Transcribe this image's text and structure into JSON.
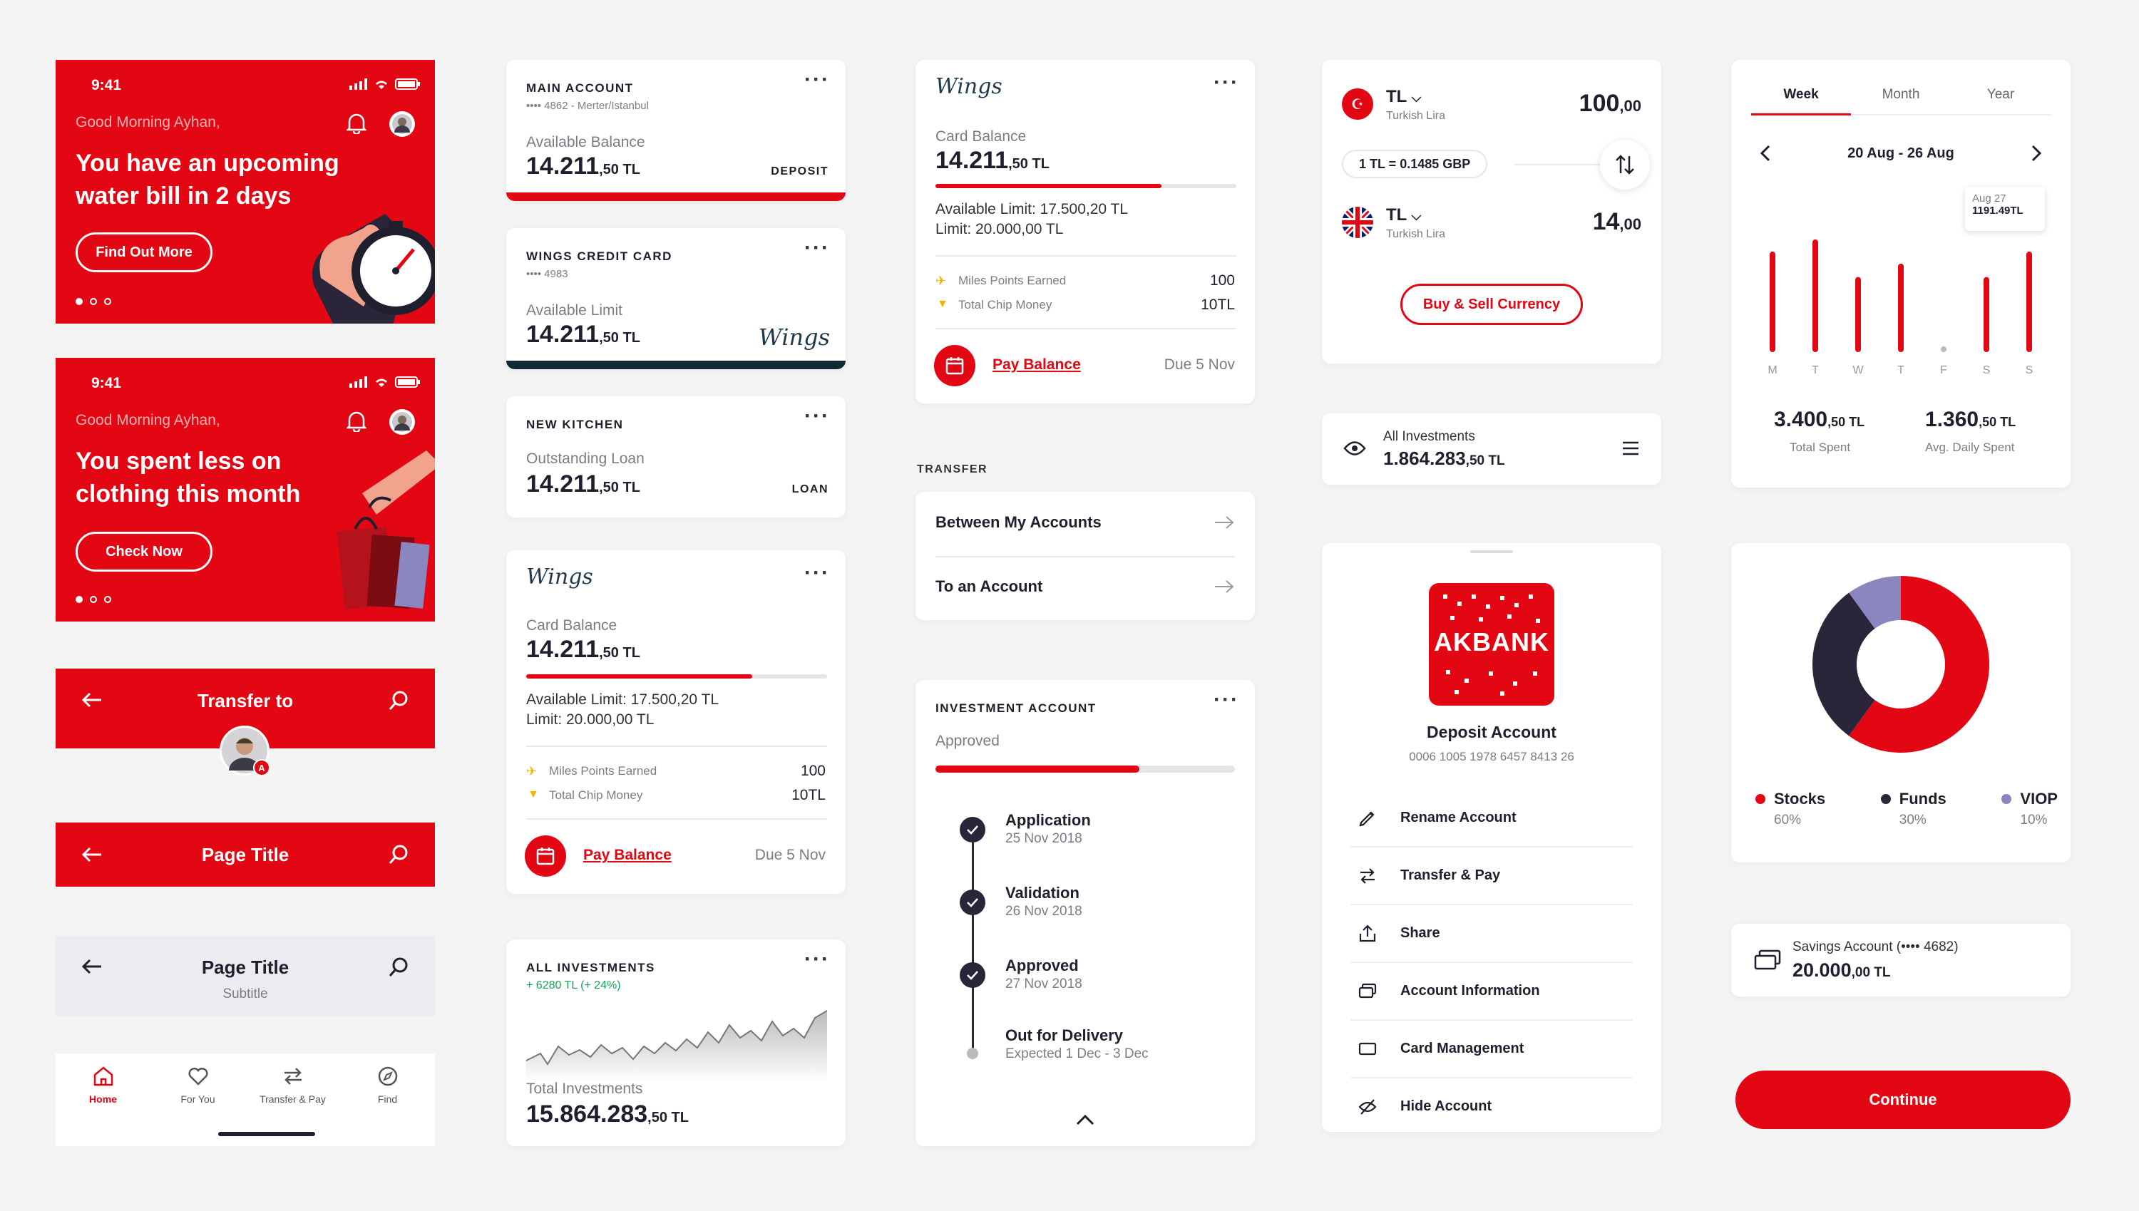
{
  "promo1": {
    "time": "9:41",
    "greeting": "Good Morning Ayhan,",
    "line1": "You have an upcoming",
    "line2": "water bill in 2 days",
    "button": "Find Out More"
  },
  "promo2": {
    "time": "9:41",
    "greeting": "Good Morning Ayhan,",
    "line1": "You spent less on",
    "line2": "clothing this month",
    "button": "Check Now"
  },
  "nav_transfer": {
    "title": "Transfer to"
  },
  "nav_red": {
    "title": "Page Title"
  },
  "nav_grey": {
    "title": "Page Title",
    "subtitle": "Subtitle"
  },
  "tabbar": {
    "items": [
      {
        "label": "Home",
        "icon": "home-icon"
      },
      {
        "label": "For You",
        "icon": "heart-icon"
      },
      {
        "label": "Transfer & Pay",
        "icon": "transfer-icon"
      },
      {
        "label": "Find",
        "icon": "compass-icon"
      }
    ]
  },
  "main_account": {
    "title": "MAIN ACCOUNT",
    "sub": "•••• 4862 - Merter/Istanbul",
    "label": "Available Balance",
    "amount": "14.211",
    "decimals": ",50 TL",
    "tag": "DEPOSIT"
  },
  "credit_card": {
    "title": "WINGS CREDIT CARD",
    "sub": "•••• 4983",
    "label": "Available Limit",
    "amount": "14.211",
    "decimals": ",50 TL",
    "brand": "Wings"
  },
  "kitchen": {
    "title": "NEW KITCHEN",
    "label": "Outstanding Loan",
    "amount": "14.211",
    "decimals": ",50 TL",
    "tag": "LOAN"
  },
  "wings_card": {
    "brand": "Wings",
    "label": "Card Balance",
    "amount": "14.211",
    "decimals": ",50 TL",
    "limit1": "Available Limit: 17.500,20 TL",
    "limit2": "Limit: 20.000,00 TL",
    "miles_label": "Miles Points Earned",
    "miles_value": "100",
    "chip_label": "Total Chip Money",
    "chip_value": "10TL",
    "pay": "Pay Balance",
    "due": "Due 5 Nov",
    "progress": 0.75
  },
  "investments_small": {
    "title": "ALL INVESTMENTS",
    "change": "+ 6280 TL (+ 24%)",
    "label": "Total Investments",
    "amount": "15.864.283",
    "decimals": ",50 TL"
  },
  "transfer": {
    "header": "TRANSFER",
    "items": [
      "Between My Accounts",
      "To an Account"
    ]
  },
  "investment_account": {
    "title": "INVESTMENT ACCOUNT",
    "status": "Approved",
    "progress": 0.68,
    "steps": [
      {
        "title": "Application",
        "date": "25 Nov 2018"
      },
      {
        "title": "Validation",
        "date": "26 Nov 2018"
      },
      {
        "title": "Approved",
        "date": "27 Nov 2018"
      },
      {
        "title": "Out for Delivery",
        "date": "Expected 1 Dec - 3 Dec"
      }
    ]
  },
  "currency": {
    "from_code": "TL",
    "from_name": "Turkish Lira",
    "from_amount": "100",
    "from_dec": ",00",
    "rate": "1 TL = 0.1485 GBP",
    "to_code": "TL",
    "to_name": "Turkish Lira",
    "to_amount": "14",
    "to_dec": ",00",
    "button": "Buy & Sell Currency"
  },
  "all_investments": {
    "label": "All Investments",
    "amount": "1.864.283",
    "decimals": ",50 TL"
  },
  "deposit": {
    "logo": "AKBANK",
    "title": "Deposit Account",
    "iban": "0006 1005 1978 6457 8413 26",
    "menu": [
      {
        "label": "Rename Account",
        "icon": "pencil-icon"
      },
      {
        "label": "Transfer & Pay",
        "icon": "transfer-icon"
      },
      {
        "label": "Share",
        "icon": "share-icon"
      },
      {
        "label": "Account Information",
        "icon": "cards-icon"
      },
      {
        "label": "Card Management",
        "icon": "card-icon"
      },
      {
        "label": "Hide Account",
        "icon": "eye-off-icon"
      }
    ]
  },
  "spending": {
    "tabs": [
      "Week",
      "Month",
      "Year"
    ],
    "range": "20 Aug - 26 Aug",
    "tooltip_date": "Aug 27",
    "tooltip_value": "1191.49TL",
    "total_amount": "3.400",
    "total_dec": ",50 TL",
    "total_label": "Total Spent",
    "avg_amount": "1.360",
    "avg_dec": ",50 TL",
    "avg_label": "Avg. Daily Spent"
  },
  "chart_data": {
    "type": "bar",
    "categories": [
      "M",
      "T",
      "W",
      "T",
      "F",
      "S",
      "S"
    ],
    "values": [
      0.83,
      0.93,
      0.62,
      0.73,
      0,
      0.62,
      0.83
    ],
    "title": "",
    "xlabel": "",
    "ylabel": ""
  },
  "portfolio": {
    "legend": [
      {
        "name": "Stocks",
        "pct": "60%",
        "color": "#e30613",
        "value": 60
      },
      {
        "name": "Funds",
        "pct": "30%",
        "color": "#2b2539",
        "value": 30
      },
      {
        "name": "VIOP",
        "pct": "10%",
        "color": "#8a86c0",
        "value": 10
      }
    ]
  },
  "savings": {
    "label": "Savings Account (•••• 4682)",
    "amount": "20.000",
    "decimals": ",00 TL"
  },
  "continue": {
    "label": "Continue"
  }
}
